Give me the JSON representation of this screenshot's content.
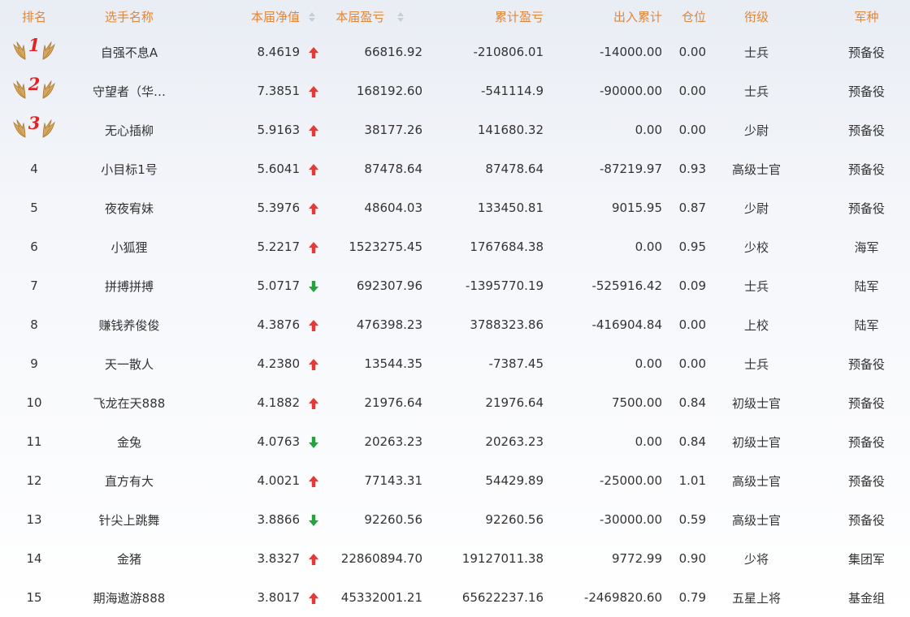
{
  "colors": {
    "header_text": "#e0873a",
    "up": "#e53935",
    "down": "#22a33b",
    "medal_number": "#e02323",
    "wing": "#d7a55b"
  },
  "headers": {
    "rank": "排名",
    "name": "选手名称",
    "nav": "本届净值",
    "current_profit": "本届盈亏",
    "cumulative_profit": "累计盈亏",
    "inout": "出入累计",
    "position": "仓位",
    "military_rank": "衔级",
    "branch": "军种"
  },
  "sortable_icons": [
    "sort-updown-icon"
  ],
  "rows": [
    {
      "rank": "1",
      "medal": true,
      "name": "自强不息A",
      "nav": "8.4619",
      "trend": "up",
      "current": "66816.92",
      "cumulative": "-210806.01",
      "inout": "-14000.00",
      "position": "0.00",
      "military_rank": "士兵",
      "branch": "预备役"
    },
    {
      "rank": "2",
      "medal": true,
      "name": "守望者（华…",
      "nav": "7.3851",
      "trend": "up",
      "current": "168192.60",
      "cumulative": "-541114.9",
      "inout": "-90000.00",
      "position": "0.00",
      "military_rank": "士兵",
      "branch": "预备役"
    },
    {
      "rank": "3",
      "medal": true,
      "name": "无心插柳",
      "nav": "5.9163",
      "trend": "up",
      "current": "38177.26",
      "cumulative": "141680.32",
      "inout": "0.00",
      "position": "0.00",
      "military_rank": "少尉",
      "branch": "预备役"
    },
    {
      "rank": "4",
      "medal": false,
      "name": "小目标1号",
      "nav": "5.6041",
      "trend": "up",
      "current": "87478.64",
      "cumulative": "87478.64",
      "inout": "-87219.97",
      "position": "0.93",
      "military_rank": "高级士官",
      "branch": "预备役"
    },
    {
      "rank": "5",
      "medal": false,
      "name": "夜夜宥妹",
      "nav": "5.3976",
      "trend": "up",
      "current": "48604.03",
      "cumulative": "133450.81",
      "inout": "9015.95",
      "position": "0.87",
      "military_rank": "少尉",
      "branch": "预备役"
    },
    {
      "rank": "6",
      "medal": false,
      "name": "小狐狸",
      "nav": "5.2217",
      "trend": "up",
      "current": "1523275.45",
      "cumulative": "1767684.38",
      "inout": "0.00",
      "position": "0.95",
      "military_rank": "少校",
      "branch": "海军"
    },
    {
      "rank": "7",
      "medal": false,
      "name": "拼搏拼搏",
      "nav": "5.0717",
      "trend": "down",
      "current": "692307.96",
      "cumulative": "-1395770.19",
      "inout": "-525916.42",
      "position": "0.09",
      "military_rank": "士兵",
      "branch": "陆军"
    },
    {
      "rank": "8",
      "medal": false,
      "name": "赚钱养俊俊",
      "nav": "4.3876",
      "trend": "up",
      "current": "476398.23",
      "cumulative": "3788323.86",
      "inout": "-416904.84",
      "position": "0.00",
      "military_rank": "上校",
      "branch": "陆军"
    },
    {
      "rank": "9",
      "medal": false,
      "name": "天一散人",
      "nav": "4.2380",
      "trend": "up",
      "current": "13544.35",
      "cumulative": "-7387.45",
      "inout": "0.00",
      "position": "0.00",
      "military_rank": "士兵",
      "branch": "预备役"
    },
    {
      "rank": "10",
      "medal": false,
      "name": "飞龙在天888",
      "nav": "4.1882",
      "trend": "up",
      "current": "21976.64",
      "cumulative": "21976.64",
      "inout": "7500.00",
      "position": "0.84",
      "military_rank": "初级士官",
      "branch": "预备役"
    },
    {
      "rank": "11",
      "medal": false,
      "name": "金兔",
      "nav": "4.0763",
      "trend": "down",
      "current": "20263.23",
      "cumulative": "20263.23",
      "inout": "0.00",
      "position": "0.84",
      "military_rank": "初级士官",
      "branch": "预备役"
    },
    {
      "rank": "12",
      "medal": false,
      "name": "直方有大",
      "nav": "4.0021",
      "trend": "up",
      "current": "77143.31",
      "cumulative": "54429.89",
      "inout": "-25000.00",
      "position": "1.01",
      "military_rank": "高级士官",
      "branch": "预备役"
    },
    {
      "rank": "13",
      "medal": false,
      "name": "针尖上跳舞",
      "nav": "3.8866",
      "trend": "down",
      "current": "92260.56",
      "cumulative": "92260.56",
      "inout": "-30000.00",
      "position": "0.59",
      "military_rank": "高级士官",
      "branch": "预备役"
    },
    {
      "rank": "14",
      "medal": false,
      "name": "金猪",
      "nav": "3.8327",
      "trend": "up",
      "current": "22860894.70",
      "cumulative": "19127011.38",
      "inout": "9772.99",
      "position": "0.90",
      "military_rank": "少将",
      "branch": "集团军"
    },
    {
      "rank": "15",
      "medal": false,
      "name": "期海遨游888",
      "nav": "3.8017",
      "trend": "up",
      "current": "45332001.21",
      "cumulative": "65622237.16",
      "inout": "-2469820.60",
      "position": "0.79",
      "military_rank": "五星上将",
      "branch": "基金组"
    }
  ]
}
